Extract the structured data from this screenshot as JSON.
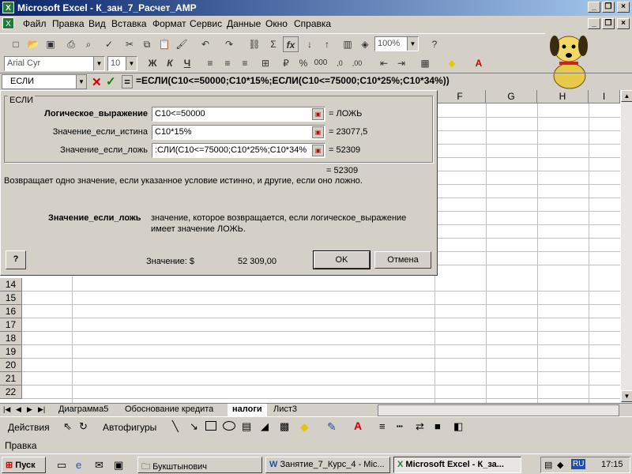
{
  "window": {
    "title": "Microsoft Excel - К_зан_7_Расчет_АМР"
  },
  "menu": [
    "Файл",
    "Правка",
    "Вид",
    "Вставка",
    "Формат",
    "Сервис",
    "Данные",
    "Окно",
    "Справка"
  ],
  "toolbar": {
    "zoom": "100%",
    "font": "Arial Cyr",
    "size": "10",
    "bold": "Ж",
    "italic": "К",
    "underline": "Ч"
  },
  "formula_bar": {
    "name_box": "ЕСЛИ",
    "eq": "=",
    "formula": "=ЕСЛИ(C10<=50000;C10*15%;ЕСЛИ(C10<=75000;C10*25%;C10*34%))"
  },
  "columns": [
    "F",
    "G",
    "H",
    "I"
  ],
  "rows": [
    "14",
    "15",
    "16",
    "17",
    "18",
    "19",
    "20",
    "21",
    "22"
  ],
  "dialog": {
    "group_label": "ЕСЛИ",
    "args": [
      {
        "label": "Логическое_выражение",
        "value": "C10<=50000",
        "result": "= ЛОЖЬ"
      },
      {
        "label": "Значение_если_истина",
        "value": "C10*15%",
        "result": "= 23077,5"
      },
      {
        "label": "Значение_если_ложь",
        "value": ":СЛИ(C10<=75000;C10*25%;C10*34%",
        "result": "= 52309"
      }
    ],
    "total": "= 52309",
    "description": "Возвращает одно значение, если указанное условие истинно, и другие, если оно ложно.",
    "arg_name": "Значение_если_ложь",
    "arg_desc_1": "значение, которое возвращается, если логическое_выражение",
    "arg_desc_2": "имеет значение ЛОЖЬ.",
    "help": "?",
    "value_label": "Значение: $",
    "value": "52 309,00",
    "ok": "OK",
    "cancel": "Отмена"
  },
  "tabs": [
    "Диаграмма5",
    "Обоснование кредита",
    "налоги",
    "Лист3"
  ],
  "draw": {
    "actions": "Действия",
    "autoshapes": "Автофигуры"
  },
  "status": "Правка",
  "taskbar": {
    "start": "Пуск",
    "items": [
      "Букштынович",
      "Занятие_7_Курс_4 - Mic...",
      "Microsoft Excel - К_за..."
    ],
    "lang": "RU",
    "time": "17:15"
  }
}
